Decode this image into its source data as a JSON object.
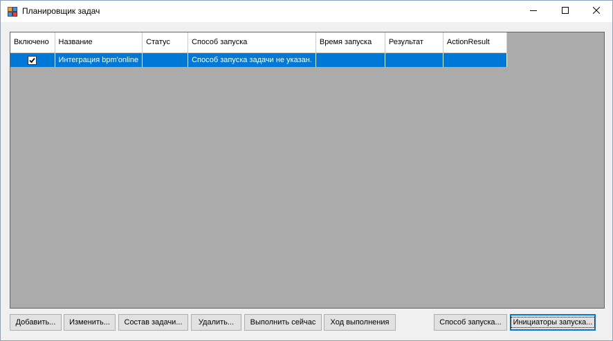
{
  "window": {
    "title": "Планировщик задач"
  },
  "grid": {
    "columns": [
      "Включено",
      "Название",
      "Статус",
      "Способ запуска",
      "Время запуска",
      "Результат",
      "ActionResult"
    ],
    "rows": [
      {
        "enabled": true,
        "name": "Интеграция bpm'online",
        "status": "",
        "launch_method": "Способ запуска задачи не указан.",
        "launch_time": "",
        "result": "",
        "action_result": ""
      }
    ]
  },
  "buttons": {
    "add": "Добавить...",
    "edit": "Изменить...",
    "task_contents": "Состав задачи...",
    "delete": "Удалить...",
    "run_now": "Выполнить сейчас",
    "progress": "Ход выполнения",
    "launch_method": "Способ запуска...",
    "launch_initiators": "Инициаторы запуска..."
  },
  "icons": {
    "app": "scheduler-app-icon",
    "minimize": "minimize-icon",
    "maximize": "maximize-icon",
    "close": "close-icon"
  },
  "colors": {
    "selection": "#0078d7",
    "grid_background": "#ababab"
  }
}
